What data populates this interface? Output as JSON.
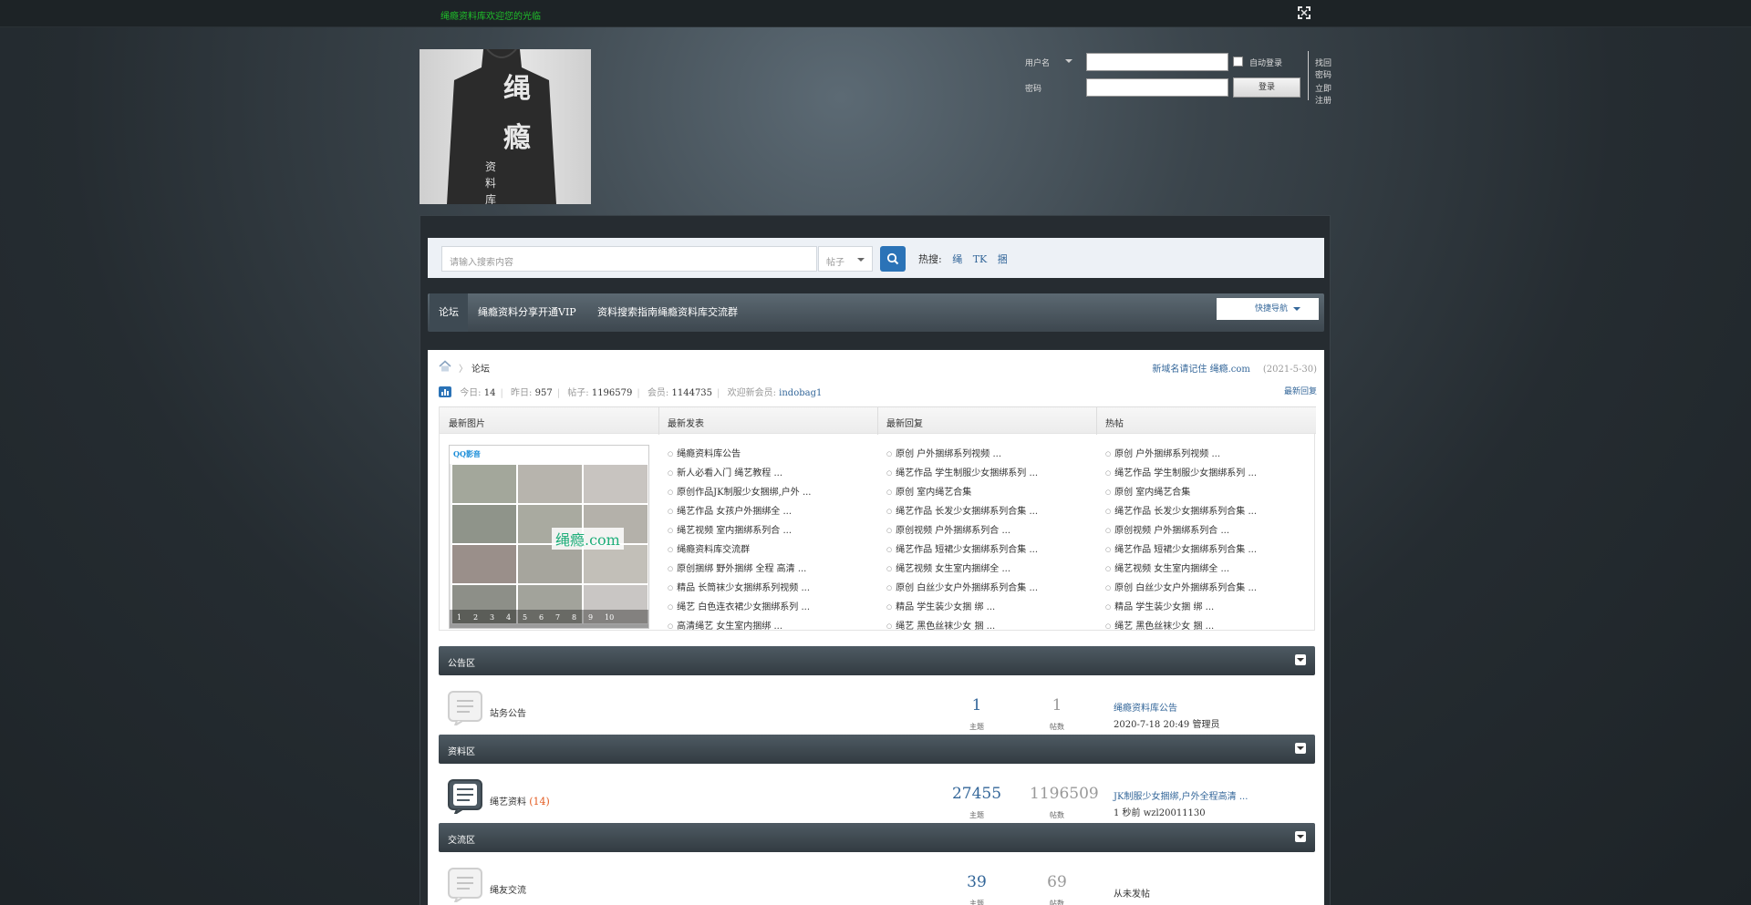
{
  "topbar": {
    "slogan": "绳瘾资料库欢迎您的光临",
    "fullscreen_icon": "fullscreen-icon"
  },
  "logo": {
    "char1": "绳",
    "char2": "瘾",
    "small": "资料库"
  },
  "login": {
    "user_label": "用户名",
    "password_label": "密码",
    "remember_label": "自动登录",
    "login_button": "登录",
    "forgot_label": "找回密码",
    "register_label": "立即注册"
  },
  "search": {
    "placeholder": "请输入搜索内容",
    "type": "帖子",
    "hot_label": "热搜:",
    "hot": [
      "绳",
      "TK",
      "捆"
    ]
  },
  "nav": {
    "items": [
      "论坛",
      "绳瘾资料分享",
      "开通VIP",
      "资料搜索指南",
      "绳瘾资料库交流群"
    ],
    "quick": "快捷导航"
  },
  "breadcrumb": {
    "current": "论坛"
  },
  "announcement": {
    "text": "新域名请记住 绳瘾.com",
    "date": "(2021-5-30)"
  },
  "stats": {
    "today_label": "今日:",
    "today": "14",
    "yesterday_label": "昨日:",
    "yesterday": "957",
    "posts_label": "帖子:",
    "posts": "1196579",
    "members_label": "会员:",
    "members": "1144735",
    "newest_label": "欢迎新会员:",
    "newest": "indobag1",
    "right": "最新回复"
  },
  "grid": {
    "headers": [
      "最新图片",
      "最新发表",
      "最新回复",
      "热帖"
    ],
    "thumb_brand": "QQ影音",
    "thumb_watermark": "绳瘾.com",
    "pages": [
      "1",
      "2",
      "3",
      "4",
      "5",
      "6",
      "7",
      "8",
      "9",
      "10"
    ],
    "col1": [
      "绳瘾资料库公告",
      "新人必看入门 绳艺教程 ...",
      "原创作品JK制服少女捆绑,户外 ...",
      "绳艺作品 女孩户外捆绑全 ...",
      "绳艺视频 室内捆绑系列合 ...",
      "绳瘾资料库交流群",
      "原创捆绑 野外捆绑 全程 高清 ...",
      "精品 长筒袜少女捆绑系列视频 ...",
      "绳艺 白色连衣裙少女捆绑系列 ...",
      "高清绳艺 女生室内捆绑 ..."
    ],
    "col2": [
      "原创 户外捆绑系列视频 ...",
      "绳艺作品 学生制服少女捆绑系列 ...",
      "原创 室内绳艺合集",
      "绳艺作品 长发少女捆绑系列合集 ...",
      "原创视频 户外捆绑系列合 ...",
      "绳艺作品 短裙少女捆绑系列合集 ...",
      "绳艺视频 女生室内捆绑全 ...",
      "原创 白丝少女户外捆绑系列合集 ...",
      "精品 学生装少女捆 绑 ...",
      "绳艺 黑色丝袜少女 捆 ..."
    ],
    "col3": [
      "原创 户外捆绑系列视频 ...",
      "绳艺作品 学生制服少女捆绑系列 ...",
      "原创 室内绳艺合集",
      "绳艺作品 长发少女捆绑系列合集 ...",
      "原创视频 户外捆绑系列合 ...",
      "绳艺作品 短裙少女捆绑系列合集 ...",
      "绳艺视频 女生室内捆绑全 ...",
      "原创 白丝少女户外捆绑系列合集 ...",
      "精品 学生装少女捆 绑 ...",
      "绳艺 黑色丝袜少女 捆 ..."
    ]
  },
  "sections": [
    {
      "title": "公告区",
      "forum": "站务公告",
      "count": "",
      "topics": "1",
      "posts": "1",
      "topics_label": "主题",
      "posts_label": "帖数",
      "last_title": "绳瘾资料库公告",
      "last_meta": "2020-7-18 20:49 管理员",
      "has_new": false
    },
    {
      "title": "资料区",
      "forum": "绳艺资料",
      "count": "(14)",
      "topics": "27455",
      "posts": "1196509",
      "topics_label": "主题",
      "posts_label": "帖数",
      "last_title": "JK制服少女捆绑,户外全程高清 ...",
      "last_meta": "1 秒前 wzl20011130",
      "has_new": true
    },
    {
      "title": "交流区",
      "forum": "绳友交流",
      "count": "",
      "topics": "39",
      "posts": "69",
      "topics_label": "主题",
      "posts_label": "帖数",
      "last_title": "",
      "last_meta": "从未发帖",
      "has_new": false
    }
  ]
}
